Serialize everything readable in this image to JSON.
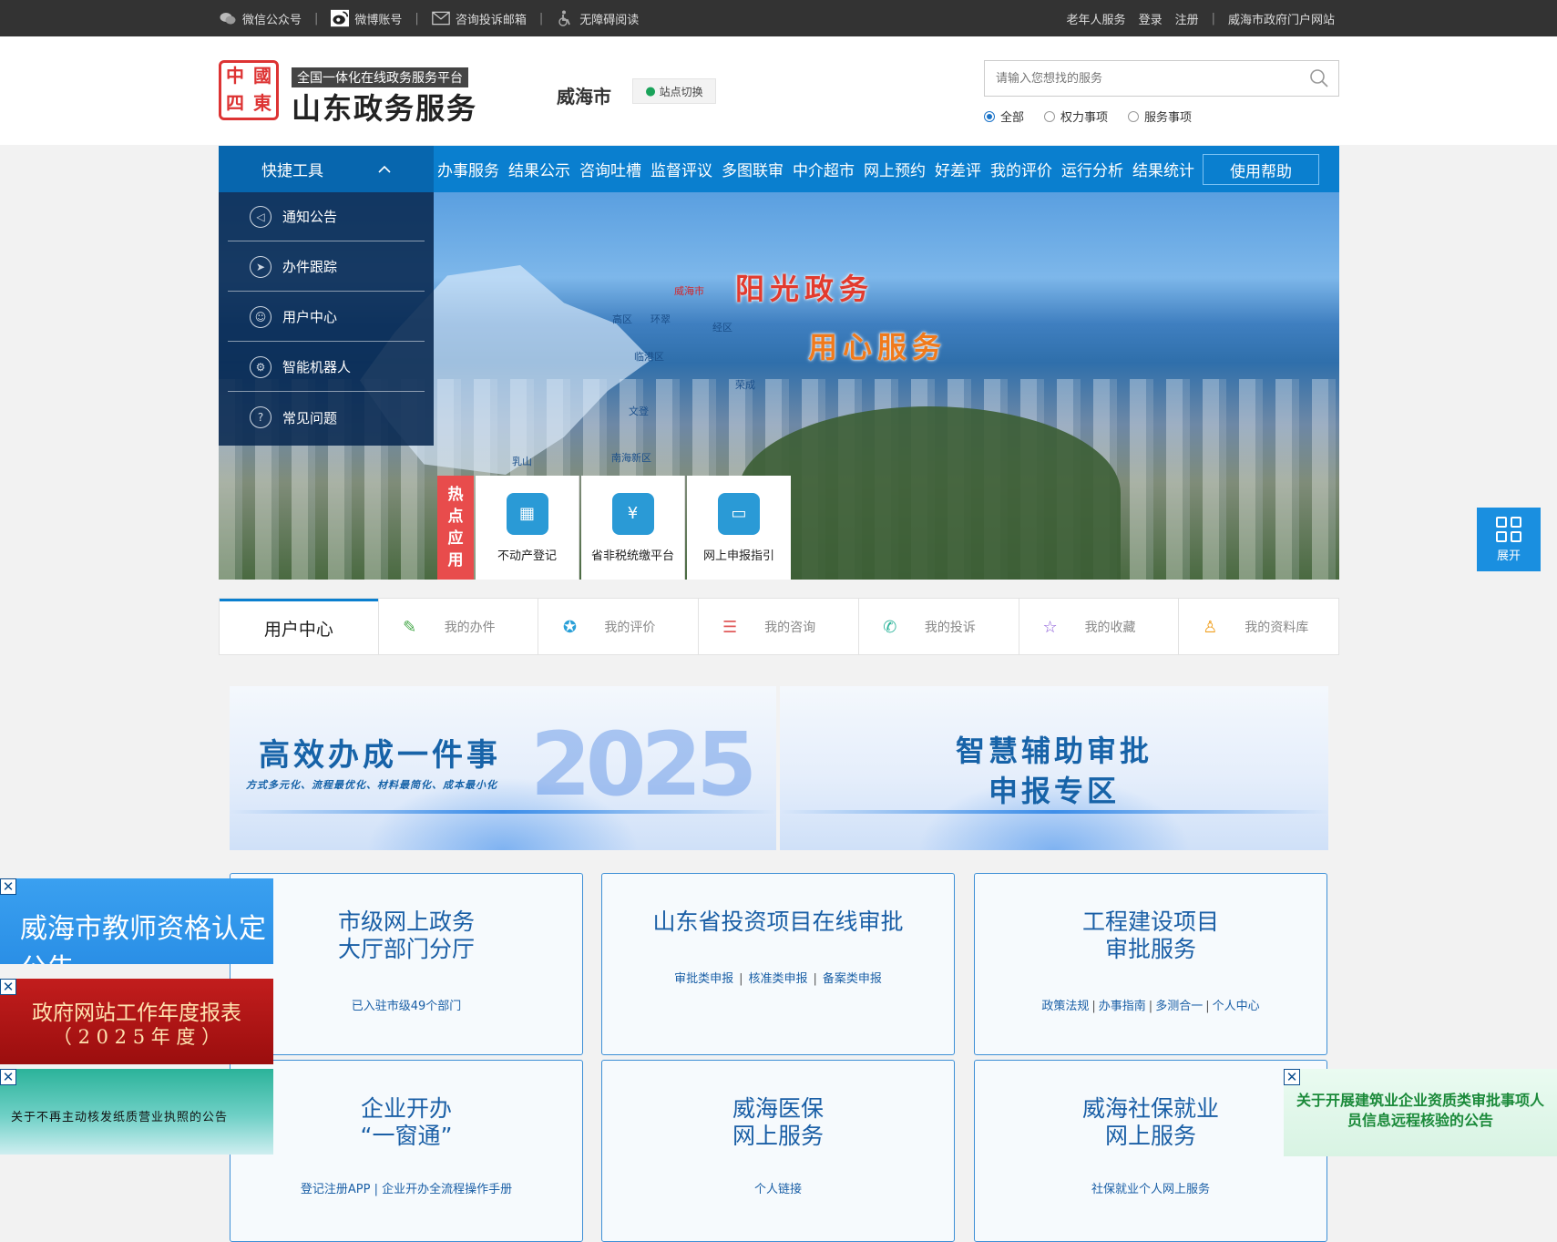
{
  "topbar": {
    "left_items": [
      {
        "icon": "wechat-icon",
        "label": "微信公众号"
      },
      {
        "icon": "weibo-icon",
        "label": "微博账号"
      },
      {
        "icon": "mail-icon",
        "label": "咨询投诉邮箱"
      },
      {
        "icon": "accessibility-icon",
        "label": "无障碍阅读"
      }
    ],
    "right_items": [
      "老年人服务",
      "登录",
      "注册"
    ],
    "portal_link": "威海市政府门户网站"
  },
  "header": {
    "seal_chars": [
      "中",
      "國",
      "四",
      "東"
    ],
    "slogan": "全国一体化在线政务服务平台",
    "brand": "山东政务服务",
    "city": "威海市",
    "switch_label": "站点切换",
    "search_placeholder": "请输入您想找的服务",
    "radios": [
      {
        "label": "全部",
        "checked": true
      },
      {
        "label": "权力事项",
        "checked": false
      },
      {
        "label": "服务事项",
        "checked": false
      }
    ]
  },
  "nav": {
    "quick_tools": "快捷工具",
    "items": [
      "办事服务",
      "结果公示",
      "咨询吐槽",
      "监督评议",
      "多图联审",
      "中介超市",
      "网上预约",
      "好差评",
      "我的评价",
      "运行分析",
      "结果统计"
    ],
    "help": "使用帮助"
  },
  "sidebar": {
    "items": [
      {
        "icon": "speaker-icon",
        "label": "通知公告"
      },
      {
        "icon": "paper-plane-icon",
        "label": "办件跟踪"
      },
      {
        "icon": "user-icon",
        "label": "用户中心"
      },
      {
        "icon": "robot-icon",
        "label": "智能机器人"
      },
      {
        "icon": "question-icon",
        "label": "常见问题"
      }
    ]
  },
  "banner": {
    "slogan1": "阳光政务",
    "slogan2": "用心服务",
    "map_labels": [
      "威海市",
      "高区",
      "环翠",
      "经区",
      "临港区",
      "荣成",
      "文登",
      "乳山",
      "南海新区"
    ]
  },
  "hot_apps": {
    "tag": [
      "热",
      "点",
      "应",
      "用"
    ],
    "apps": [
      {
        "icon": "building-icon",
        "label": "不动产登记"
      },
      {
        "icon": "payment-icon",
        "label": "省非税统缴平台"
      },
      {
        "icon": "laptop-icon",
        "label": "网上申报指引"
      }
    ]
  },
  "expand_label": "展开",
  "user_center": {
    "title": "用户中心",
    "tabs": [
      {
        "icon": "pencil-icon",
        "label": "我的办件",
        "color": "#46a84a"
      },
      {
        "icon": "badge-icon",
        "label": "我的评价",
        "color": "#2aa0d8"
      },
      {
        "icon": "message-icon",
        "label": "我的咨询",
        "color": "#e05a5a"
      },
      {
        "icon": "phone-icon",
        "label": "我的投诉",
        "color": "#2cb49a"
      },
      {
        "icon": "star-icon",
        "label": "我的收藏",
        "color": "#8a5ad8"
      },
      {
        "icon": "person-icon",
        "label": "我的资料库",
        "color": "#f0a020"
      }
    ]
  },
  "features": {
    "left_title": "高效办成一件事",
    "left_sub": "方式多元化、流程最优化、材料最简化、成本最小化",
    "left_year": "2025",
    "right_title1": "智慧辅助审批",
    "right_title2": "申报专区"
  },
  "cards": [
    {
      "title1": "市级网上政务",
      "title2": "大厅部门分厅",
      "links": [
        "已入驻市级49个部门"
      ]
    },
    {
      "title1": "山东省投资项目在线审批",
      "title2": "",
      "links": [
        "审批类申报",
        "核准类申报",
        "备案类申报"
      ]
    },
    {
      "title1": "工程建设项目",
      "title2": "审批服务",
      "links": [
        "政策法规",
        "办事指南",
        "多测合一",
        "个人中心"
      ]
    },
    {
      "title1": "企业开办",
      "title2": "“一窗通”",
      "links": [
        "登记注册APP | 企业开办全流程操作手册"
      ]
    },
    {
      "title1": "威海医保",
      "title2": "网上服务",
      "links": [
        "个人链接"
      ]
    },
    {
      "title1": "威海社保就业",
      "title2": "网上服务",
      "links": [
        "社保就业个人网上服务"
      ]
    }
  ],
  "ads": {
    "ad1": "威海市教师资格认定公告",
    "ad2_line1": "政府网站工作年度报表",
    "ad2_line2": "（ 2 0 2 5 年 度 ）",
    "ad3": "关于不再主动核发纸质营业执照的公告",
    "ad_right": "关于开展建筑业企业资质类审批事项人员信息远程核验的公告",
    "close": "✕"
  }
}
